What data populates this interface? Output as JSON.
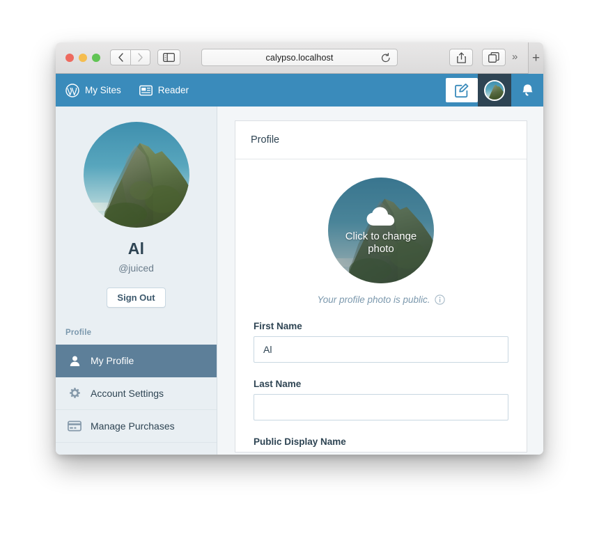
{
  "browser": {
    "url": "calypso.localhost",
    "back_icon": "chevron-left-icon",
    "forward_icon": "chevron-right-icon",
    "sidebar_icon": "sidebar-toggle-icon",
    "reload_icon": "reload-icon",
    "share_icon": "share-icon",
    "tabs_icon": "tab-overview-icon",
    "overflow_label": "»",
    "newtab_label": "+"
  },
  "masterbar": {
    "my_sites_label": "My Sites",
    "my_sites_icon": "wordpress-logo-icon",
    "reader_label": "Reader",
    "reader_icon": "reader-icon",
    "write_icon": "write-post-icon",
    "avatar_icon": "user-avatar",
    "notifications_icon": "bell-icon",
    "bar_color": "#3a8bbb",
    "avatar_bg_color": "#2e4453"
  },
  "sidebar": {
    "avatar_name": "profile-photo",
    "display_name": "Al",
    "handle": "@juiced",
    "sign_out_label": "Sign Out",
    "section_label": "Profile",
    "items": [
      {
        "label": "My Profile",
        "icon": "person-icon",
        "selected": true
      },
      {
        "label": "Account Settings",
        "icon": "gear-icon",
        "selected": false
      },
      {
        "label": "Manage Purchases",
        "icon": "credit-card-icon",
        "selected": false
      }
    ],
    "selected_color": "#5d7f99"
  },
  "main": {
    "card_title": "Profile",
    "photo": {
      "upload_icon": "cloud-upload-icon",
      "upload_label": "Click to change photo",
      "note": "Your profile photo is public.",
      "note_icon": "info-icon"
    },
    "fields": [
      {
        "label": "First Name",
        "value": "Al",
        "placeholder": ""
      },
      {
        "label": "Last Name",
        "value": "",
        "placeholder": ""
      }
    ],
    "next_label": "Public Display Name"
  }
}
